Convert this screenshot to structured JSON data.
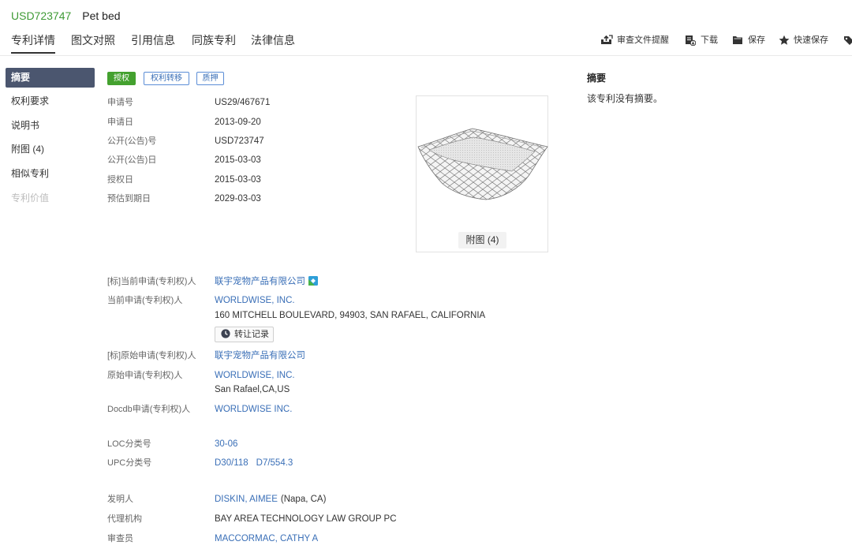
{
  "header": {
    "patent_number": "USD723747",
    "title": "Pet bed",
    "tabs": [
      {
        "label": "专利详情",
        "active": true
      },
      {
        "label": "图文对照"
      },
      {
        "label": "引用信息"
      },
      {
        "label": "同族专利"
      },
      {
        "label": "法律信息"
      }
    ],
    "toolbar": [
      {
        "label": "审查文件提醒",
        "icon": "review-alert-icon"
      },
      {
        "label": "下载",
        "icon": "download-icon"
      },
      {
        "label": "保存",
        "icon": "save-folder-icon"
      },
      {
        "label": "快速保存",
        "icon": "star-icon"
      },
      {
        "icon": "tag-icon"
      }
    ]
  },
  "sidebar": {
    "items": [
      {
        "label": "摘要",
        "state": "active"
      },
      {
        "label": "权利要求"
      },
      {
        "label": "说明书"
      },
      {
        "label": "附图 (4)"
      },
      {
        "label": "相似专利"
      },
      {
        "label": "专利价值",
        "state": "disabled"
      }
    ]
  },
  "badges": [
    {
      "label": "授权",
      "style": "granted"
    },
    {
      "label": "权利转移",
      "style": "outline"
    },
    {
      "label": "质押",
      "style": "outline"
    }
  ],
  "basic_info": [
    {
      "label": "申请号",
      "value": "US29/467671"
    },
    {
      "label": "申请日",
      "value": "2013-09-20"
    },
    {
      "label": "公开(公告)号",
      "value": "USD723747"
    },
    {
      "label": "公开(公告)日",
      "value": "2015-03-03"
    },
    {
      "label": "授权日",
      "value": "2015-03-03"
    },
    {
      "label": "预估到期日",
      "value": "2029-03-03"
    }
  ],
  "figure": {
    "button_label": "附图 (4)"
  },
  "parties": {
    "std_current": {
      "label": "[标]当前申请(专利权)人",
      "value": "联宇宠物产品有限公司"
    },
    "current": {
      "label": "当前申请(专利权)人",
      "value": "WORLDWISE, INC.",
      "address": "160 MITCHELL BOULEVARD, 94903, SAN RAFAEL, CALIFORNIA",
      "transfer_button": "转让记录"
    },
    "std_original": {
      "label": "[标]原始申请(专利权)人",
      "value": "联宇宠物产品有限公司"
    },
    "original": {
      "label": "原始申请(专利权)人",
      "value": "WORLDWISE, INC.",
      "address": "San Rafael,CA,US"
    },
    "docdb": {
      "label": "Docdb申请(专利权)人",
      "value": "WORLDWISE INC."
    }
  },
  "classification": {
    "loc": {
      "label": "LOC分类号",
      "value": "30-06"
    },
    "upc": {
      "label": "UPC分类号",
      "values": [
        "D30/118",
        "D7/554.3"
      ]
    }
  },
  "people": {
    "inventor": {
      "label": "发明人",
      "name": "DISKIN, AIMEE",
      "location": "(Napa, CA)"
    },
    "agency": {
      "label": "代理机构",
      "value": "BAY AREA TECHNOLOGY LAW GROUP PC"
    },
    "examiner": {
      "label": "审查员",
      "value": "MACCORMAC, CATHY A"
    }
  },
  "abstract": {
    "heading": "摘要",
    "text": "该专利没有摘要。"
  },
  "colors": {
    "patent_number": "#3f9a36",
    "link": "#3a6fb7",
    "sidebar_active": "#4b566f",
    "granted_badge": "#44a12f",
    "outline_badge": "#5b8dd6"
  }
}
